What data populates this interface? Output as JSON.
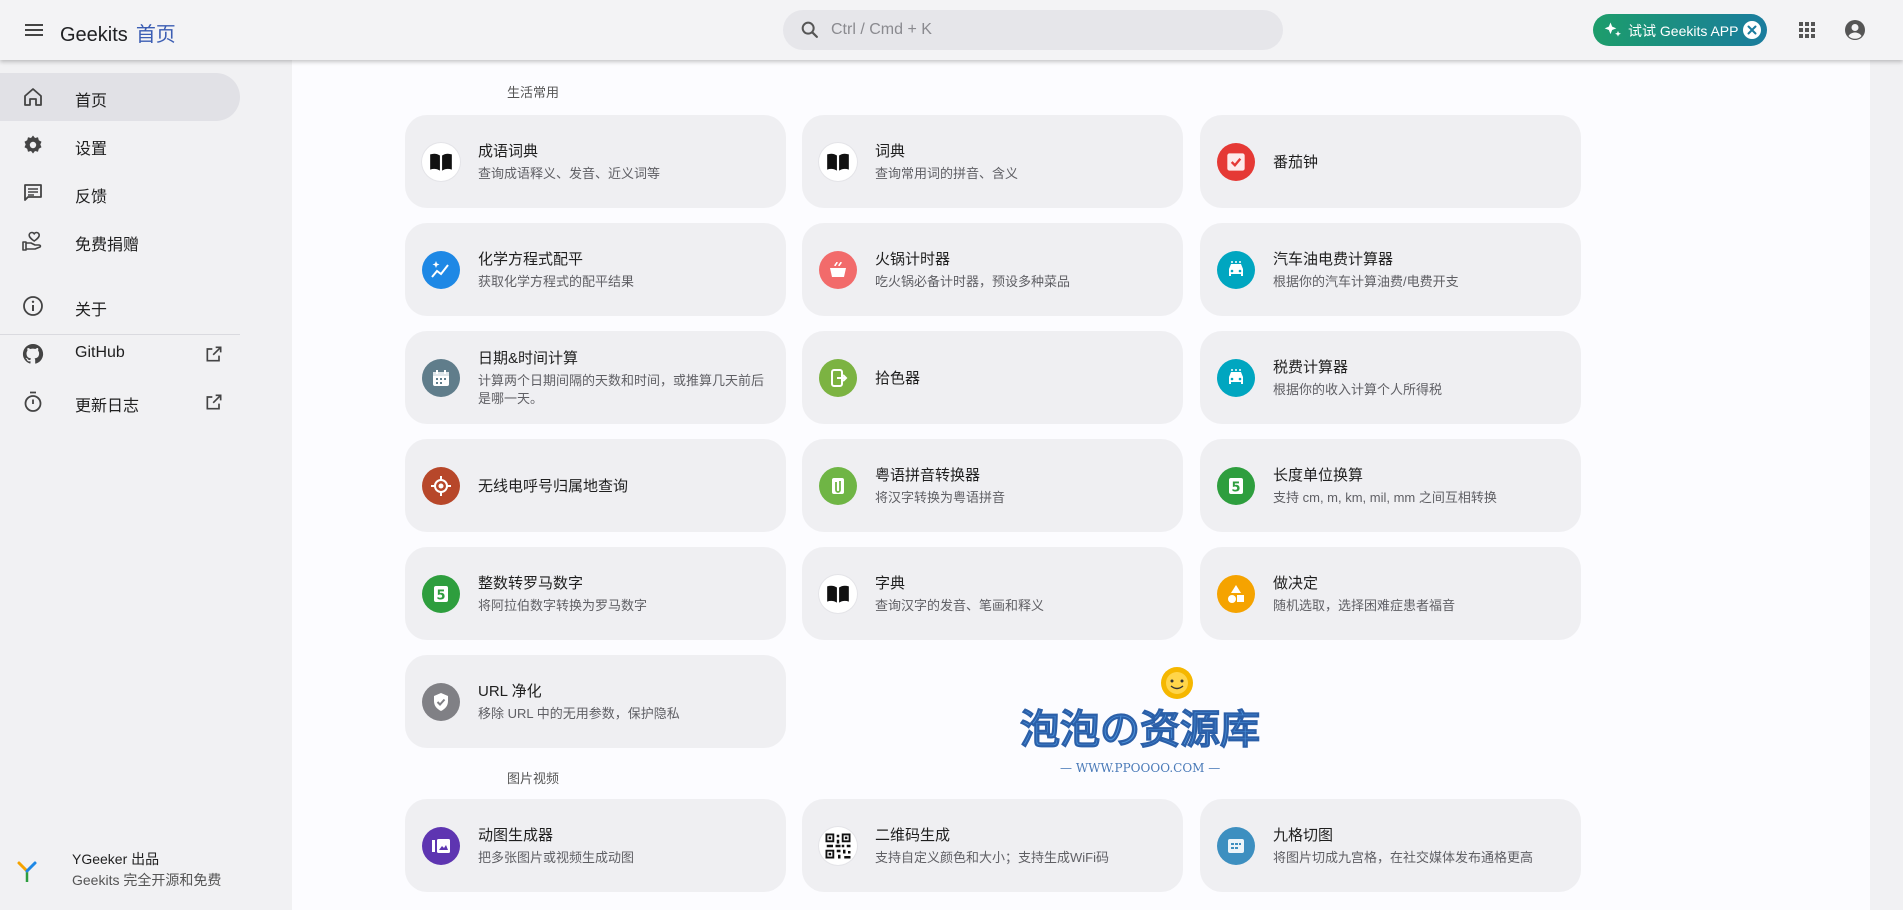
{
  "header": {
    "brand": "Geekits",
    "page": "首页",
    "search_placeholder": "Ctrl / Cmd + K",
    "app_button_label": "试试 Geekits APP"
  },
  "sidebar": {
    "items": [
      {
        "label": "首页",
        "icon": "home-icon"
      },
      {
        "label": "设置",
        "icon": "gear-icon"
      },
      {
        "label": "反馈",
        "icon": "feedback-icon"
      },
      {
        "label": "免费捐赠",
        "icon": "donate-icon"
      },
      {
        "label": "关于",
        "icon": "info-icon"
      },
      {
        "label": "GitHub",
        "icon": "github-icon"
      },
      {
        "label": "更新日志",
        "icon": "timer-icon"
      }
    ],
    "footer": {
      "line1": "YGeeker 出品",
      "line2": "Geekits 完全开源和免费"
    }
  },
  "sections": {
    "life": "生活常用",
    "media": "图片视频"
  },
  "cards": [
    {
      "title": "成语词典",
      "desc": "查询成语释义、发音、近义词等",
      "icon": "book-icon",
      "color": "#ffffff"
    },
    {
      "title": "词典",
      "desc": "查询常用词的拼音、含义",
      "icon": "book-icon",
      "color": "#ffffff"
    },
    {
      "title": "番茄钟",
      "desc": "",
      "icon": "tomato-timer-icon",
      "color": "#e53935"
    },
    {
      "title": "化学方程式配平",
      "desc": "获取化学方程式的配平结果",
      "icon": "sparkle-chart-icon",
      "color": "#1e88e5"
    },
    {
      "title": "火锅计时器",
      "desc": "吃火锅必备计时器，预设多种菜品",
      "icon": "hotpot-icon",
      "color": "#f26b6b"
    },
    {
      "title": "汽车油电费计算器",
      "desc": "根据你的汽车计算油费/电费开支",
      "icon": "car-icon",
      "color": "#00a6c0"
    },
    {
      "title": "日期&时间计算",
      "desc": "计算两个日期间隔的天数和时间，或推算几天前后是哪一天。",
      "icon": "calendar-icon",
      "color": "#607d8b"
    },
    {
      "title": "拾色器",
      "desc": "",
      "icon": "color-picker-icon",
      "color": "#7cb342"
    },
    {
      "title": "税费计算器",
      "desc": "根据你的收入计算个人所得税",
      "icon": "car-icon",
      "color": "#00a6c0"
    },
    {
      "title": "无线电呼号归属地查询",
      "desc": "",
      "icon": "radio-target-icon",
      "color": "#b7472a"
    },
    {
      "title": "粤语拼音转换器",
      "desc": "将汉字转换为粤语拼音",
      "icon": "clip-icon",
      "color": "#6fb545"
    },
    {
      "title": "长度单位换算",
      "desc": "支持 cm, m, km, mil, mm 之间互相转换",
      "icon": "number-five-icon",
      "color": "#2e9e3e"
    },
    {
      "title": "整数转罗马数字",
      "desc": "将阿拉伯数字转换为罗马数字",
      "icon": "number-five-icon",
      "color": "#2e9e3e"
    },
    {
      "title": "字典",
      "desc": "查询汉字的发音、笔画和释义",
      "icon": "book-icon",
      "color": "#ffffff"
    },
    {
      "title": "做决定",
      "desc": "随机选取，选择困难症患者福音",
      "icon": "shapes-icon",
      "color": "#f5a300"
    },
    {
      "title": "URL 净化",
      "desc": "移除 URL 中的无用参数，保护隐私",
      "icon": "shield-check-icon",
      "color": "#808085"
    },
    {
      "title": "动图生成器",
      "desc": "把多张图片或视频生成动图",
      "icon": "gif-icon",
      "color": "#5e35b1"
    },
    {
      "title": "二维码生成",
      "desc": "支持自定义颜色和大小；支持生成WiFi码",
      "icon": "qr-icon",
      "color": "#ffffff"
    },
    {
      "title": "九格切图",
      "desc": "将图片切成九宫格，在社交媒体发布通格更高",
      "icon": "grid-image-icon",
      "color": "#3d8fc0"
    }
  ],
  "watermark": {
    "title": "泡泡の资源库",
    "url": "— WWW.PPOOOO.COM —"
  }
}
